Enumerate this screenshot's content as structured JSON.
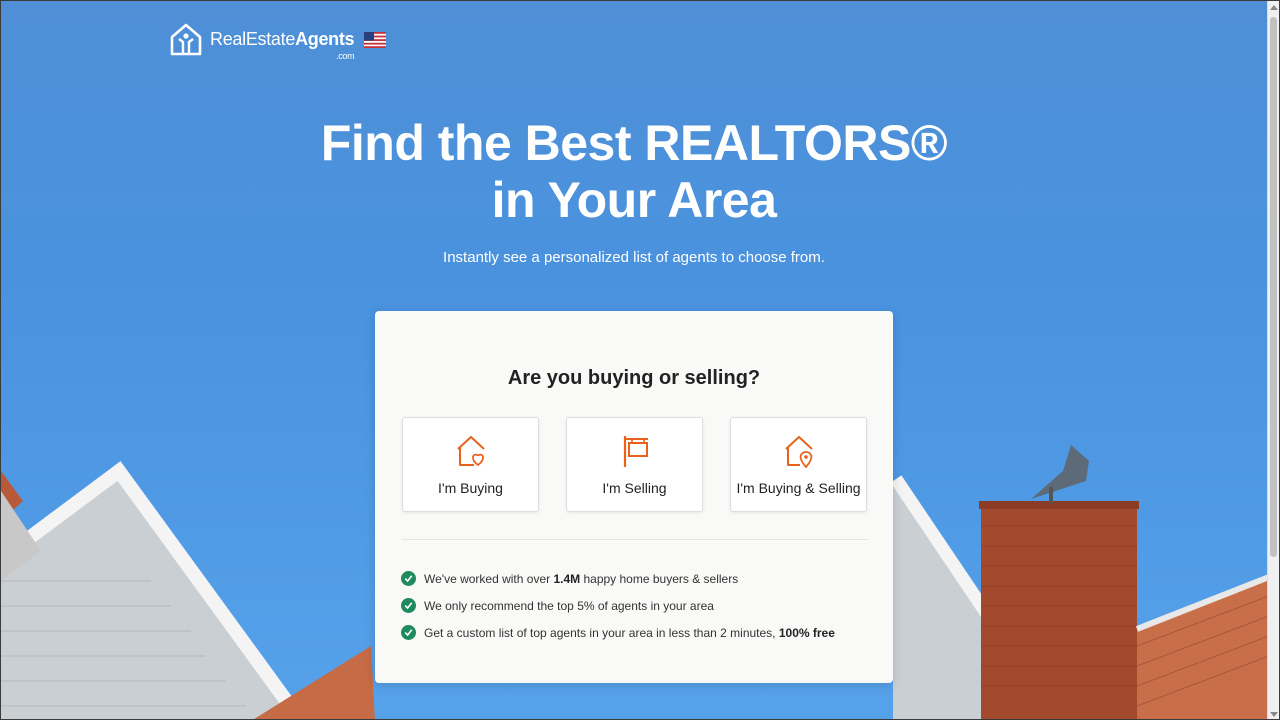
{
  "header": {
    "logo_text_regular": "RealEstate",
    "logo_text_bold": "Agents",
    "logo_suffix": ".com",
    "flag_icon": "us-flag-icon"
  },
  "hero": {
    "title_line1": "Find the Best REALTORS®",
    "title_line2": "in Your Area",
    "subtitle": "Instantly see a personalized list of agents to choose from."
  },
  "card": {
    "question": "Are you buying or selling?",
    "options": [
      {
        "label": "I'm Buying",
        "icon": "house-heart-icon"
      },
      {
        "label": "I'm Selling",
        "icon": "sale-sign-icon"
      },
      {
        "label": "I'm Buying & Selling",
        "icon": "house-pin-icon"
      }
    ],
    "benefits": [
      {
        "pre": "We've worked with over ",
        "bold": "1.4M",
        "post": " happy home buyers & sellers"
      },
      {
        "pre": "We only recommend the top 5% of agents in your area",
        "bold": "",
        "post": ""
      },
      {
        "pre": "Get a custom list of top agents in your area in less than 2 minutes, ",
        "bold": "100% free",
        "post": ""
      }
    ]
  },
  "colors": {
    "accent_orange": "#e8621c",
    "check_green": "#1f8a5c",
    "sky_blue": "#4a93e0"
  }
}
